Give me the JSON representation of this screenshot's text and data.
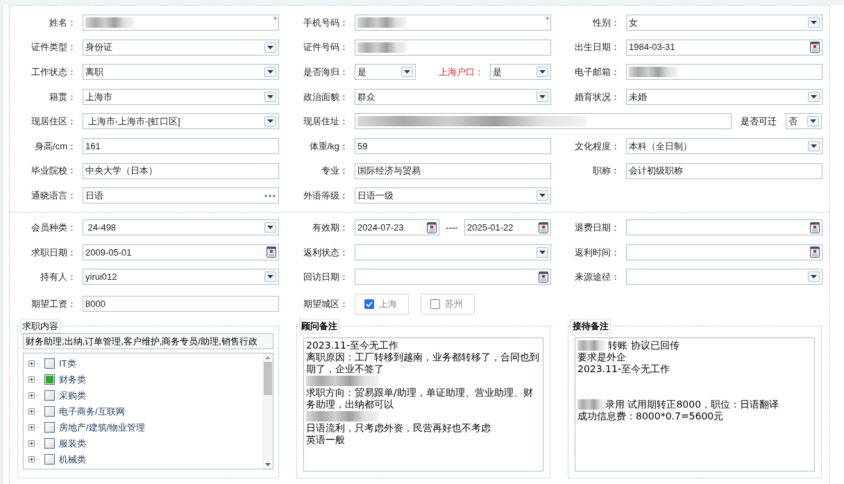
{
  "basic_info": {
    "rows": [
      [
        {
          "kind": "text",
          "label": "姓名：",
          "redacted": true,
          "required_mark": "*"
        },
        {
          "kind": "text",
          "label": "手机号码：",
          "redacted": true,
          "required_mark": "*"
        },
        {
          "kind": "select",
          "label": "性别：",
          "value": "女"
        }
      ],
      [
        {
          "kind": "select",
          "label": "证件类型：",
          "value": "身份证"
        },
        {
          "kind": "text",
          "label": "证件号码：",
          "redacted": true
        },
        {
          "kind": "date",
          "label": "出生日期：",
          "value": "1984-03-31"
        }
      ],
      [
        {
          "kind": "select",
          "label": "工作状态：",
          "value": "离职"
        },
        {
          "kind": "pair",
          "label": "是否海归：",
          "value": "是",
          "second": {
            "label": "上海户口：",
            "value": "是",
            "emphasis": true
          }
        },
        {
          "kind": "text",
          "label": "电子邮箱：",
          "redacted": true
        }
      ],
      [
        {
          "kind": "select",
          "label": "籍贯：",
          "value": "上海市"
        },
        {
          "kind": "select",
          "label": "政治面貌：",
          "value": "群众"
        },
        {
          "kind": "select",
          "label": "婚育状况：",
          "value": "未婚"
        }
      ],
      [
        {
          "kind": "select",
          "label": "现居住区：",
          "value": " 上海市-上海市-[虹口区]"
        },
        {
          "kind": "address",
          "label": "现居住址：",
          "redacted": true,
          "extra": {
            "label": "是否可迁",
            "value": "否"
          }
        }
      ],
      [
        {
          "kind": "text",
          "label": "身高/cm：",
          "value": "161"
        },
        {
          "kind": "text",
          "label": "体重/kg：",
          "value": "59"
        },
        {
          "kind": "select",
          "label": "文化程度：",
          "value": "本科（全日制）"
        }
      ],
      [
        {
          "kind": "text",
          "label": "毕业院校：",
          "value": "中央大学（日本）"
        },
        {
          "kind": "text",
          "label": "专业：",
          "value": "国际经济与贸易"
        },
        {
          "kind": "text",
          "label": "职称：",
          "value": "会计初级职称"
        }
      ],
      [
        {
          "kind": "lookup",
          "label": "通晓语言：",
          "value": "日语"
        },
        {
          "kind": "select",
          "label": "外语等级：",
          "value": "日语一级"
        }
      ]
    ]
  },
  "membership": {
    "rows": [
      [
        {
          "kind": "select",
          "label": "会员种类：",
          "value": " 24-498"
        },
        {
          "kind": "date_range",
          "label": "有效期：",
          "from": "2024-07-23",
          "separator": "----",
          "to": "2025-01-22"
        },
        {
          "kind": "date",
          "label": "退费日期："
        }
      ],
      [
        {
          "kind": "date",
          "label": "求职日期：",
          "value": "2009-05-01"
        },
        {
          "kind": "select",
          "label": "返利状态："
        },
        {
          "kind": "date",
          "label": "返利时间："
        }
      ],
      [
        {
          "kind": "select",
          "label": "持有人：",
          "value": "yirui012"
        },
        {
          "kind": "date",
          "label": "回访日期："
        },
        {
          "kind": "select",
          "label": "来源途径："
        }
      ],
      [
        {
          "kind": "text",
          "label": "期望工资：",
          "value": "8000"
        },
        {
          "kind": "checks",
          "label": "期望城区：",
          "options": [
            {
              "label": "上海",
              "checked": true
            },
            {
              "label": "苏州",
              "checked": false
            }
          ]
        }
      ]
    ]
  },
  "job_content": {
    "legend": "求职内容",
    "value": "财务助理,出纳,订单管理,客户维护,商务专员/助理,销售行政",
    "tree": [
      {
        "label": "IT类",
        "checked": false
      },
      {
        "label": "财务类",
        "checked": true
      },
      {
        "label": "采购类",
        "checked": false
      },
      {
        "label": "电子商务/互联网",
        "checked": false
      },
      {
        "label": "房地产/建筑/物业管理",
        "checked": false
      },
      {
        "label": "服装类",
        "checked": false
      },
      {
        "label": "机械类",
        "checked": false
      }
    ]
  },
  "notes": [
    {
      "legend": "顾问备注",
      "lines": [
        {
          "kind": "text",
          "text": "2023.11-至今无工作"
        },
        {
          "kind": "text",
          "text": "离职原因：工厂转移到越南，业务都转移了，合同也到期了，企业不签了"
        },
        {
          "kind": "redacted"
        },
        {
          "kind": "text",
          "text": "求职方向：贸易跟单/助理，单证助理、营业助理、财务助理，出纳都可以"
        },
        {
          "kind": "redacted"
        },
        {
          "kind": "text",
          "text": "日语流利，只考虑外资，民营再好也不考虑"
        },
        {
          "kind": "text",
          "text": "英语一般"
        }
      ]
    },
    {
      "legend": "接待备注",
      "lines": [
        {
          "kind": "prefixed",
          "text": " 转账 协议已回传"
        },
        {
          "kind": "text",
          "text": "要求是外企"
        },
        {
          "kind": "text",
          "text": "2023.11-至今无工作"
        },
        {
          "kind": "blank"
        },
        {
          "kind": "blank"
        },
        {
          "kind": "prefixed",
          "text": "录用 试用期转正8000，职位：日语翻译"
        },
        {
          "kind": "text",
          "text": "成功信息费：8000*0.7=5600元"
        }
      ]
    }
  ]
}
